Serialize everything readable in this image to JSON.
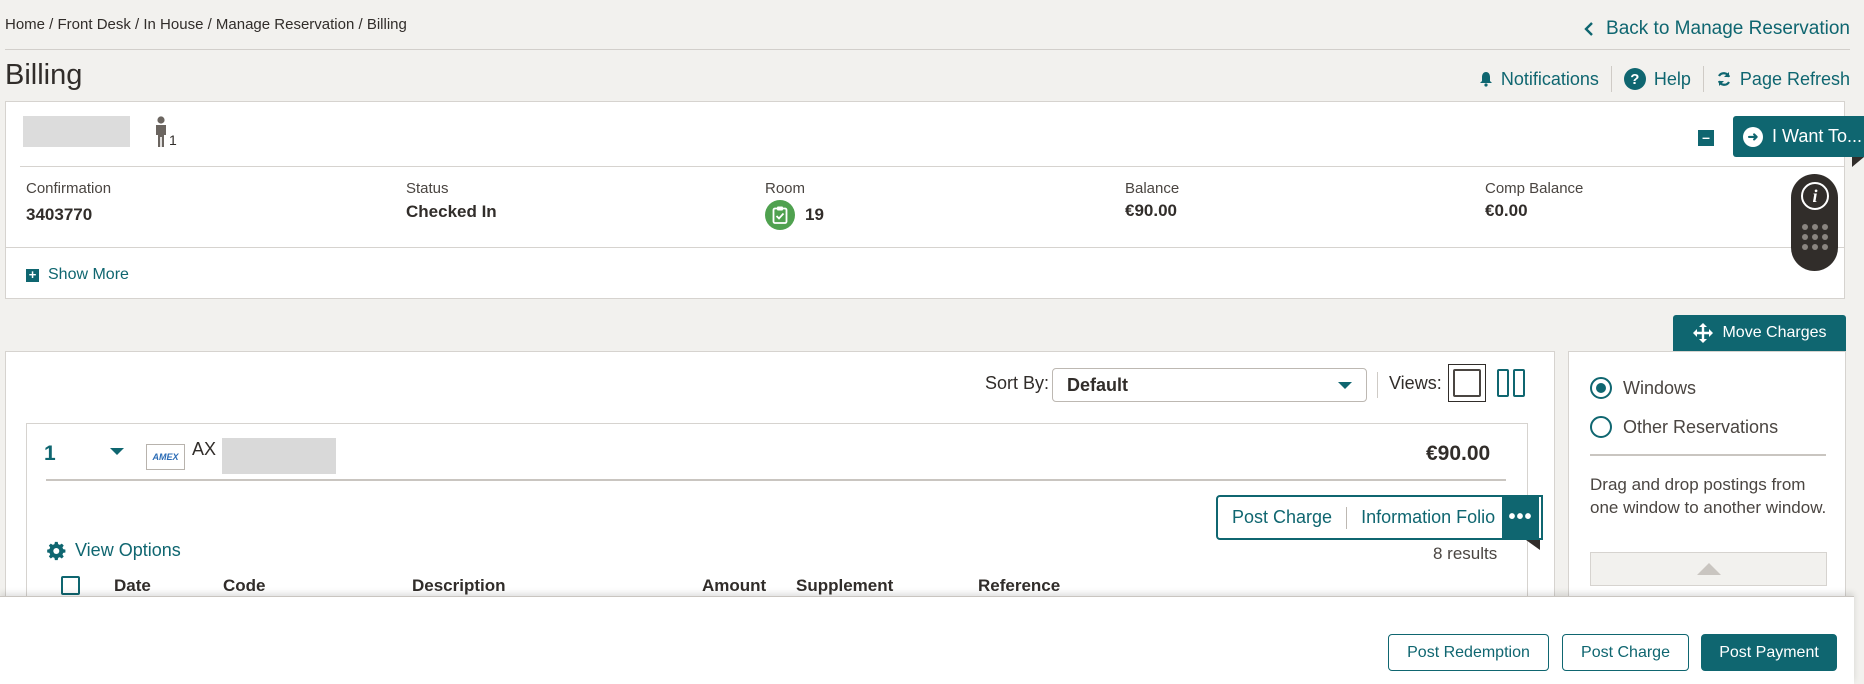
{
  "breadcrumb": "Home / Front Desk / In House / Manage Reservation / Billing",
  "back_link": "Back to Manage Reservation",
  "page_title": "Billing",
  "top_actions": {
    "notifications": "Notifications",
    "help": "Help",
    "help_glyph": "?",
    "page_refresh": "Page Refresh"
  },
  "guest": {
    "count": "1"
  },
  "i_want_to": "I Want To...",
  "collapse_glyph": "–",
  "info_glyph": "i",
  "reservation": {
    "confirmation_label": "Confirmation",
    "confirmation_value": "3403770",
    "status_label": "Status",
    "status_value": "Checked In",
    "room_label": "Room",
    "room_value": "19",
    "balance_label": "Balance",
    "balance_value": "€90.00",
    "comp_balance_label": "Comp Balance",
    "comp_balance_value": "€0.00"
  },
  "show_more": "Show More",
  "show_more_glyph": "+",
  "move_charges": "Move Charges",
  "sort": {
    "label": "Sort By:",
    "value": "Default"
  },
  "views_label": "Views:",
  "window": {
    "number": "1",
    "card_logo": "AMEX",
    "card_code": "AX",
    "amount": "€90.00"
  },
  "window_actions": {
    "post_charge": "Post Charge",
    "information_folio": "Information Folio",
    "more": "•••"
  },
  "view_options": "View Options",
  "results": "8 results",
  "table_headers": {
    "date": "Date",
    "code": "Code",
    "description": "Description",
    "amount": "Amount",
    "supplement": "Supplement",
    "reference": "Reference"
  },
  "right_panel": {
    "option_windows": "Windows",
    "option_other": "Other Reservations",
    "selected": "Windows",
    "help_text": "Drag and drop postings from one window to another window."
  },
  "footer": {
    "post_redemption": "Post Redemption",
    "post_charge": "Post Charge",
    "post_payment": "Post Payment"
  },
  "colors": {
    "accent": "#0f6670",
    "room_badge": "#4fa14f",
    "background": "#f2f1ee"
  }
}
